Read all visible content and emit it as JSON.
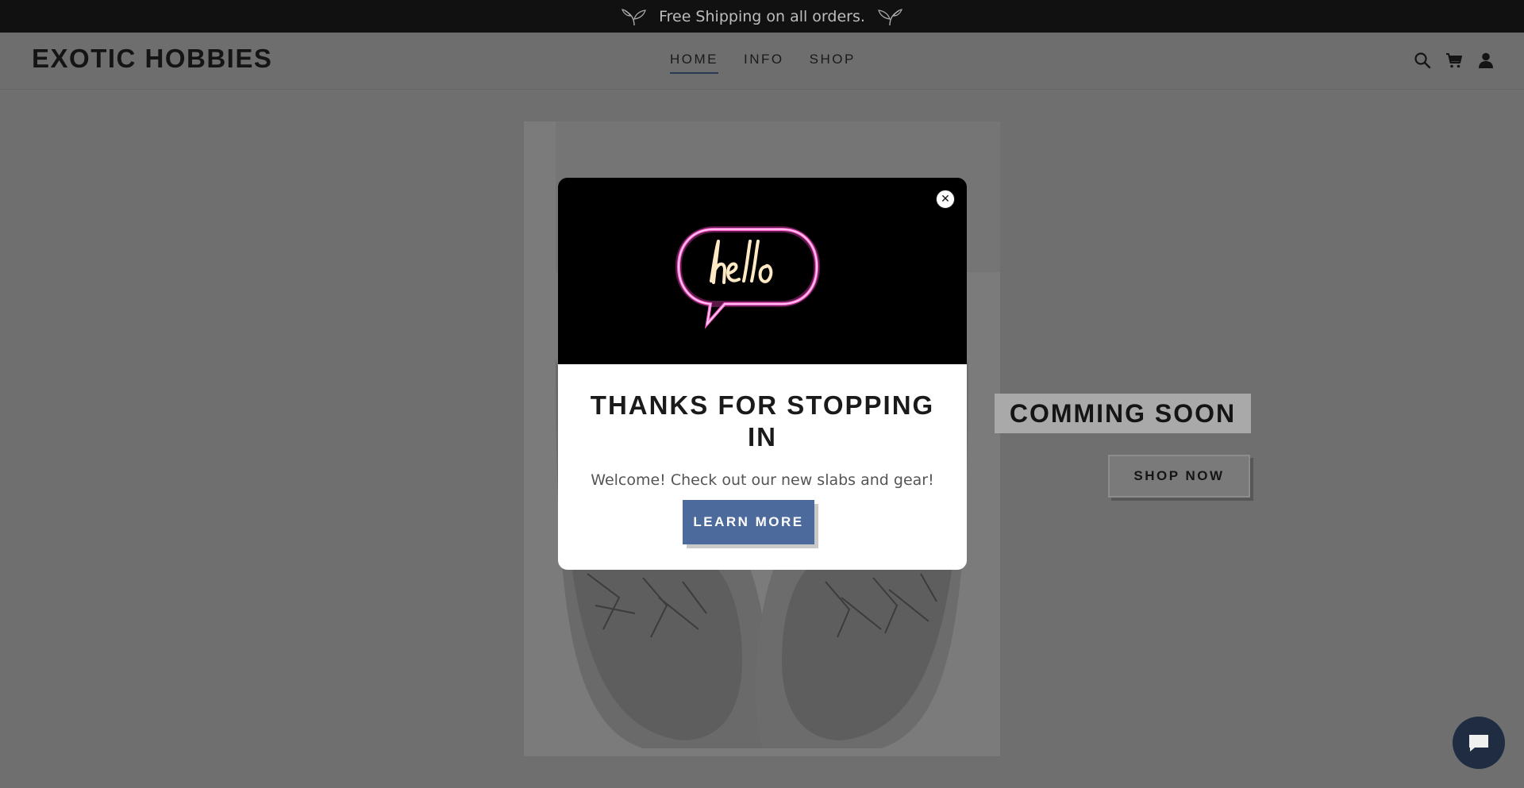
{
  "announcement": {
    "text": "Free Shipping on all orders.",
    "icon": "sprig-icon"
  },
  "header": {
    "logo": "EXOTIC HOBBIES",
    "nav": [
      {
        "label": "HOME",
        "active": true
      },
      {
        "label": "INFO",
        "active": false
      },
      {
        "label": "SHOP",
        "active": false
      }
    ],
    "icons": [
      "search-icon",
      "cart-icon",
      "account-icon"
    ]
  },
  "hero": {
    "badge": "COMMING SOON",
    "button": "SHOP NOW"
  },
  "popup": {
    "title": "THANKS FOR STOPPING IN",
    "message": "Welcome! Check out our new slabs and gear!",
    "button": "LEARN MORE",
    "close_icon": "close-icon",
    "image_icon": "neon-hello-sign"
  },
  "colors": {
    "accent": "#4d6a9d",
    "overlay": "#6f6f6f",
    "announce_bg": "#111111",
    "chat_bg": "#1f2c42"
  }
}
